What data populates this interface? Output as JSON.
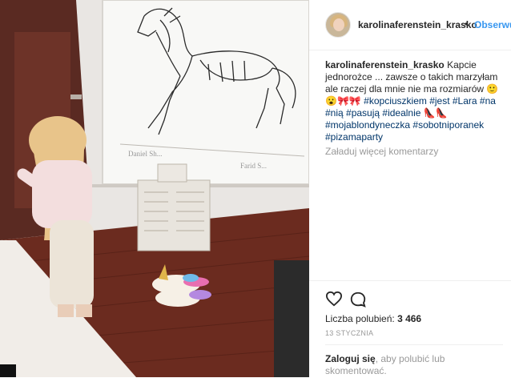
{
  "post": {
    "username": "karolinaferenstein_krasko",
    "follow_label": "Obserwuj",
    "dot": "•",
    "caption": {
      "username": "karolinaferenstein_krasko",
      "text": "Kapcie jednorożce ... zawsze o takich marzyłam ale raczej dla mnie nie ma rozmiarów 🙂",
      "emoji_line": "😮🎀🎀",
      "tags_line1": "#kopciuszkiem #jest #Lara #na",
      "tags_line2": "#nią #pasują #idealnie 👠👠",
      "tags_line3": "#mojablondyneczka #sobotniporanek",
      "tags_line4": "#pizamaparty"
    },
    "load_more": "Załaduj więcej komentarzy",
    "likes_label": "Liczba polubień:",
    "likes_count": "3 466",
    "date": "13 STYCZNIA",
    "login_link": "Zaloguj się",
    "login_rest": ", aby polubić lub skomentować."
  },
  "icons": {
    "like": "heart-icon",
    "comment": "comment-icon"
  },
  "colors": {
    "link": "#003569",
    "follow": "#3897f0",
    "muted": "#999999",
    "text": "#262626"
  }
}
